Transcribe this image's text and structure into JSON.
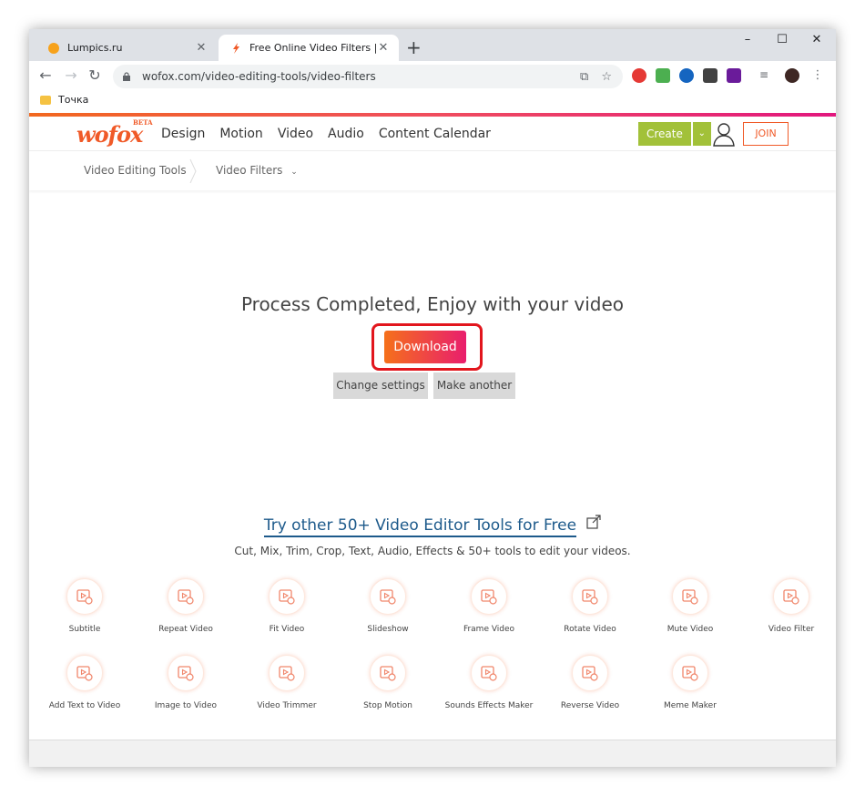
{
  "browser": {
    "tabs": [
      {
        "title": "Lumpics.ru",
        "favicon": "orange-circle-icon"
      },
      {
        "title": "Free Online Video Filters | WoFox",
        "favicon": "wofox-icon"
      }
    ],
    "url": "wofox.com/video-editing-tools/video-filters",
    "bookmark": "Точка"
  },
  "site": {
    "logo": "wofox",
    "logo_badge": "BETA",
    "nav": [
      "Design",
      "Motion",
      "Video",
      "Audio",
      "Content Calendar"
    ],
    "create_label": "Create",
    "join_label": "JOIN",
    "breadcrumb": [
      "Video Editing Tools",
      "Video Filters"
    ],
    "accent": "#f05a28",
    "create_color": "#a2c139"
  },
  "main": {
    "process_text": "Process Completed, Enjoy with your video",
    "download_label": "Download",
    "change_settings_label": "Change settings",
    "make_another_label": "Make another",
    "try_title": "Try other 50+ Video Editor Tools for Free",
    "try_subtitle": "Cut, Mix, Trim, Crop, Text, Audio, Effects & 50+ tools to edit your videos."
  },
  "tools": [
    "Subtitle",
    "Repeat Video",
    "Fit Video",
    "Slideshow",
    "Frame Video",
    "Rotate Video",
    "Mute Video",
    "Video Filter",
    "Add Text to Video",
    "Image to Video",
    "Video Trimmer",
    "Stop Motion",
    "Sounds Effects Maker",
    "Reverse Video",
    "Meme Maker"
  ]
}
